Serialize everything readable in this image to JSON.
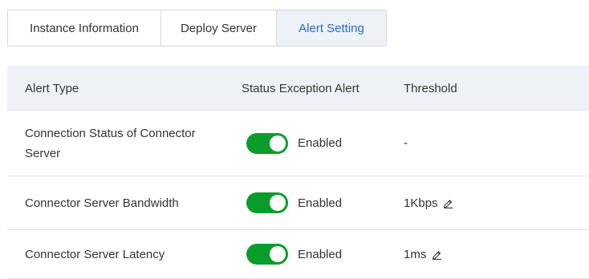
{
  "tabs": [
    {
      "label": "Instance Information",
      "active": false
    },
    {
      "label": "Deploy Server",
      "active": false
    },
    {
      "label": "Alert Setting",
      "active": true
    }
  ],
  "table": {
    "headers": {
      "alert_type": "Alert Type",
      "status_exception_alert": "Status Exception Alert",
      "threshold": "Threshold"
    },
    "rows": [
      {
        "alert_type": "Connection Status of Connector Server",
        "toggle_on": true,
        "status_label": "Enabled",
        "threshold": "-",
        "threshold_editable": false
      },
      {
        "alert_type": "Connector Server Bandwidth",
        "toggle_on": true,
        "status_label": "Enabled",
        "threshold": "1Kbps",
        "threshold_editable": true,
        "edit_icon": "pencil-edit-icon"
      },
      {
        "alert_type": "Connector Server Latency",
        "toggle_on": true,
        "status_label": "Enabled",
        "threshold": "1ms",
        "threshold_editable": true,
        "edit_icon": "pencil-edit-icon"
      }
    ]
  },
  "colors": {
    "accent_blue": "#1f6fc5",
    "toggle_green": "#0b9d2b",
    "header_bg": "#eef2f7",
    "border": "#d9d9d9"
  }
}
